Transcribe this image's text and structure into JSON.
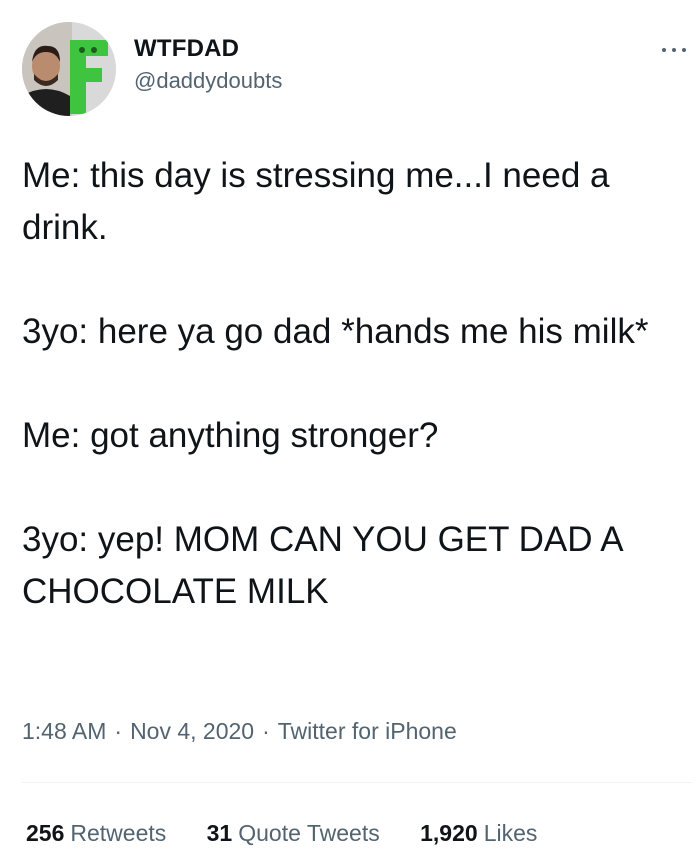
{
  "author": {
    "display_name": "WTFDAD",
    "handle": "@daddydoubts",
    "avatar_icon": "profile-photo-with-green-f-logo"
  },
  "more_icon": "ellipsis-icon",
  "tweet": {
    "paragraphs": [
      "Me: this day is stressing me...I need a drink.",
      "3yo: here ya go dad *hands me his milk*",
      "Me: got anything stronger?",
      "3yo: yep! MOM CAN YOU GET DAD A CHOCOLATE MILK"
    ],
    "time": "1:48 AM",
    "date": "Nov 4, 2020",
    "source": "Twitter for iPhone",
    "separator": "·"
  },
  "stats": {
    "retweets": {
      "count": "256",
      "label": "Retweets"
    },
    "quotes": {
      "count": "31",
      "label": "Quote Tweets"
    },
    "likes": {
      "count": "1,920",
      "label": "Likes"
    }
  },
  "colors": {
    "text": "#0f1419",
    "secondary": "#536471",
    "divider": "#eff3f4",
    "logo_green": "#3ec43e"
  }
}
